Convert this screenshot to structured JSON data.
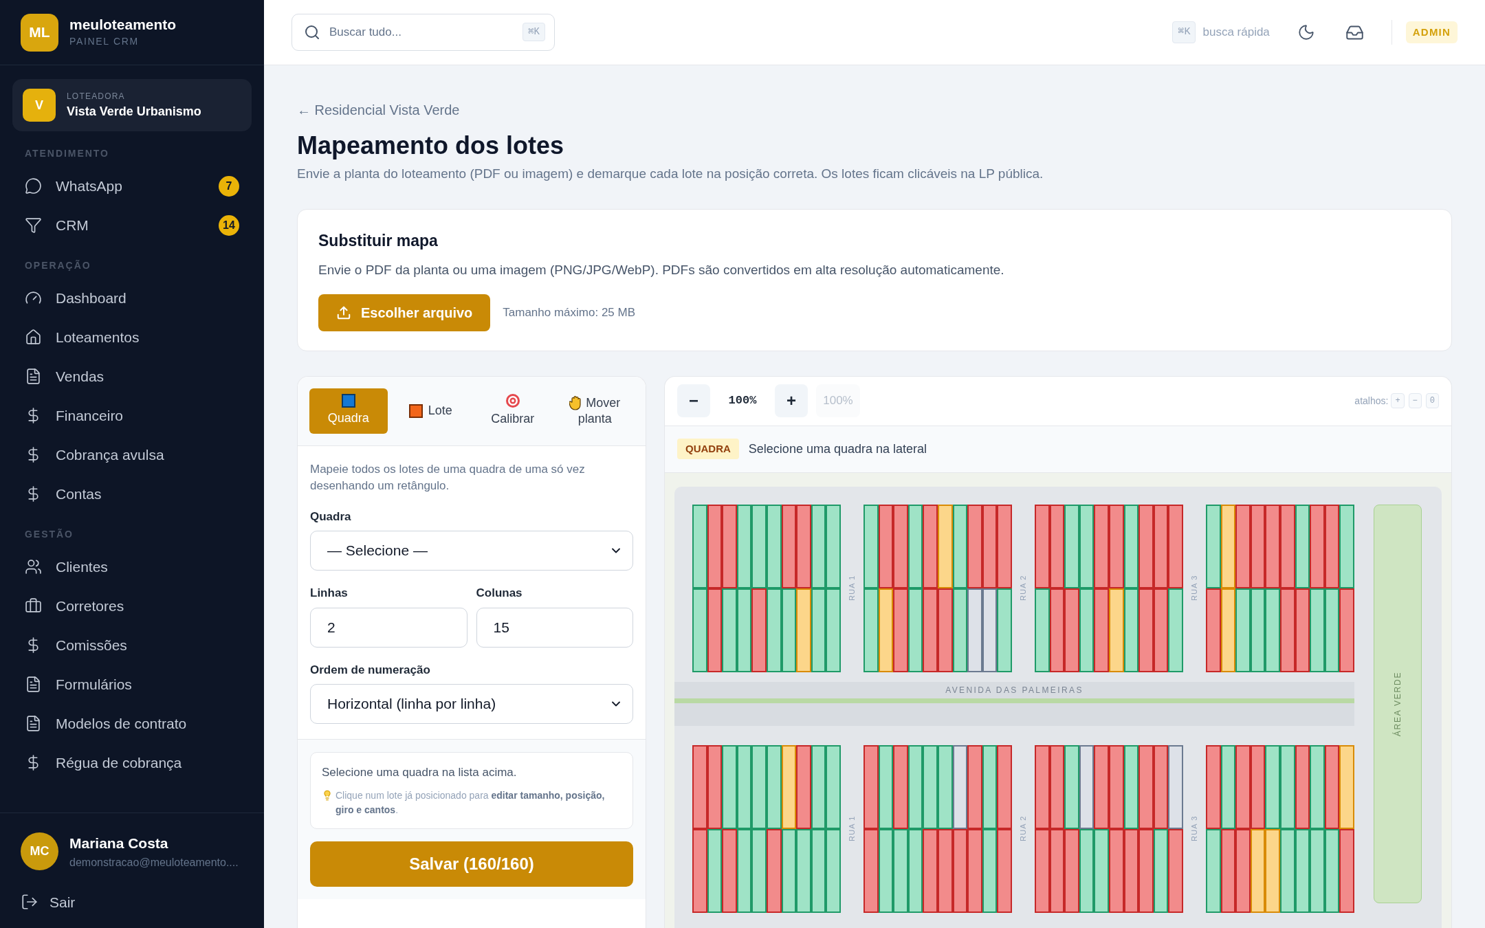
{
  "sidebar": {
    "logo": {
      "initials": "ML",
      "name": "meuloteamento",
      "subtitle": "PAINEL CRM"
    },
    "company": {
      "initial": "V",
      "label": "LOTEADORA",
      "name": "Vista Verde Urbanismo"
    },
    "sections": [
      {
        "title": "ATENDIMENTO",
        "items": [
          {
            "label": "WhatsApp",
            "badge": "7"
          },
          {
            "label": "CRM",
            "badge": "14"
          }
        ]
      },
      {
        "title": "OPERAÇÃO",
        "items": [
          {
            "label": "Dashboard"
          },
          {
            "label": "Loteamentos"
          },
          {
            "label": "Vendas"
          },
          {
            "label": "Financeiro"
          },
          {
            "label": "Cobrança avulsa"
          },
          {
            "label": "Contas"
          }
        ]
      },
      {
        "title": "GESTÃO",
        "items": [
          {
            "label": "Clientes"
          },
          {
            "label": "Corretores"
          },
          {
            "label": "Comissões"
          },
          {
            "label": "Formulários"
          },
          {
            "label": "Modelos de contrato"
          },
          {
            "label": "Régua de cobrança"
          }
        ]
      }
    ],
    "user": {
      "initials": "MC",
      "name": "Mariana Costa",
      "email": "demonstracao@meuloteamento...."
    },
    "logout": "Sair"
  },
  "topbar": {
    "search": {
      "placeholder": "Buscar tudo...",
      "shortcut": "⌘K"
    },
    "quick_search": {
      "shortcut": "⌘K",
      "label": "busca rápida"
    },
    "role": "ADMIN"
  },
  "breadcrumb": "← Residencial Vista Verde",
  "title": "Mapeamento dos lotes",
  "description": "Envie a planta do loteamento (PDF ou imagem) e demarque cada lote na posição correta. Os lotes ficam clicáveis na LP pública.",
  "upload": {
    "title": "Substituir mapa",
    "text": "Envie o PDF da planta ou uma imagem (PNG/JPG/WebP). PDFs são convertidos em alta resolução automaticamente.",
    "button": "Escolher arquivo",
    "hint": "Tamanho máximo: 25 MB"
  },
  "tools": {
    "tabs": [
      {
        "label": "Quadra",
        "selected": true
      },
      {
        "label": "Lote",
        "selected": false
      },
      {
        "label": "Calibrar",
        "selected": false
      },
      {
        "label": "Mover planta",
        "selected": false
      }
    ],
    "help": "Mapeie todos os lotes de uma quadra de uma só vez desenhando um retângulo.",
    "block_field": {
      "label": "Quadra",
      "value": "— Selecione —"
    },
    "rows_field": {
      "label": "Linhas",
      "value": "2"
    },
    "cols_field": {
      "label": "Colunas",
      "value": "15"
    },
    "order_field": {
      "label": "Ordem de numeração",
      "value": "Horizontal (linha por linha)"
    },
    "info": {
      "text": "Selecione uma quadra na lista acima.",
      "tip": "Clique num lote já posicionado para **editar tamanho, posição, giro e cantos**."
    },
    "save": "Salvar (160/160)"
  },
  "map": {
    "zoom_out": "−",
    "zoom": "100%",
    "zoom_in": "+",
    "zoom_reset": "100%",
    "shortcuts_label": "atalhos:",
    "shortcuts": [
      "+",
      "−",
      "0"
    ],
    "mode": {
      "badge": "QUADRA",
      "text": "Selecione uma quadra na lateral"
    },
    "streets_top": [
      "RUA 1",
      "RUA 2",
      "RUA 3"
    ],
    "streets_bottom": [
      "RUA 1",
      "RUA 2",
      "RUA 3"
    ],
    "avenue": "AVENIDA DAS PALMEIRAS",
    "green_area": "ÁREA VERDE",
    "blocks": [
      {
        "rows": [
          [
            {
              "color": "#9fe3c6"
            },
            {
              "color": "#f28b8b"
            },
            {
              "color": "#f28b8b"
            },
            {
              "color": "#9fe3c6"
            },
            {
              "color": "#9fe3c6"
            },
            {
              "color": "#9fe3c6"
            },
            {
              "color": "#f28b8b"
            },
            {
              "color": "#f28b8b"
            },
            {
              "color": "#9fe3c6"
            },
            {
              "color": "#9fe3c6"
            }
          ],
          [
            {
              "color": "#9fe3c6"
            },
            {
              "color": "#f28b8b"
            },
            {
              "color": "#9fe3c6"
            },
            {
              "color": "#9fe3c6"
            },
            {
              "color": "#f28b8b"
            },
            {
              "color": "#9fe3c6"
            },
            {
              "color": "#9fe3c6"
            },
            {
              "color": "#fcd68a"
            },
            {
              "color": "#9fe3c6"
            },
            {
              "color": "#9fe3c6"
            }
          ]
        ]
      },
      {
        "rows": [
          [
            {
              "color": "#9fe3c6"
            },
            {
              "color": "#f28b8b"
            },
            {
              "color": "#f28b8b"
            },
            {
              "color": "#9fe3c6"
            },
            {
              "color": "#f28b8b"
            },
            {
              "color": "#fcd68a"
            },
            {
              "color": "#9fe3c6"
            },
            {
              "color": "#f28b8b"
            },
            {
              "color": "#f28b8b"
            },
            {
              "color": "#f28b8b"
            }
          ],
          [
            {
              "color": "#9fe3c6"
            },
            {
              "color": "#fcd68a"
            },
            {
              "color": "#f28b8b"
            },
            {
              "color": "#9fe3c6"
            },
            {
              "color": "#f28b8b"
            },
            {
              "color": "#f28b8b"
            },
            {
              "color": "#9fe3c6"
            },
            {
              "color": "#dde1e8"
            },
            {
              "color": "#dde1e8"
            },
            {
              "color": "#9fe3c6"
            }
          ]
        ]
      },
      {
        "rows": [
          [
            {
              "color": "#f28b8b"
            },
            {
              "color": "#f28b8b"
            },
            {
              "color": "#9fe3c6"
            },
            {
              "color": "#9fe3c6"
            },
            {
              "color": "#f28b8b"
            },
            {
              "color": "#f28b8b"
            },
            {
              "color": "#9fe3c6"
            },
            {
              "color": "#f28b8b"
            },
            {
              "color": "#f28b8b"
            },
            {
              "color": "#f28b8b"
            }
          ],
          [
            {
              "color": "#9fe3c6"
            },
            {
              "color": "#f28b8b"
            },
            {
              "color": "#f28b8b"
            },
            {
              "color": "#9fe3c6"
            },
            {
              "color": "#f28b8b"
            },
            {
              "color": "#fcd68a"
            },
            {
              "color": "#9fe3c6"
            },
            {
              "color": "#f28b8b"
            },
            {
              "color": "#f28b8b"
            },
            {
              "color": "#9fe3c6"
            }
          ]
        ]
      },
      {
        "rows": [
          [
            {
              "color": "#9fe3c6"
            },
            {
              "color": "#fcd68a"
            },
            {
              "color": "#f28b8b"
            },
            {
              "color": "#f28b8b"
            },
            {
              "color": "#f28b8b"
            },
            {
              "color": "#f28b8b"
            },
            {
              "color": "#9fe3c6"
            },
            {
              "color": "#f28b8b"
            },
            {
              "color": "#f28b8b"
            },
            {
              "color": "#9fe3c6"
            }
          ],
          [
            {
              "color": "#f28b8b"
            },
            {
              "color": "#fcd68a"
            },
            {
              "color": "#9fe3c6"
            },
            {
              "color": "#9fe3c6"
            },
            {
              "color": "#9fe3c6"
            },
            {
              "color": "#f28b8b"
            },
            {
              "color": "#f28b8b"
            },
            {
              "color": "#9fe3c6"
            },
            {
              "color": "#9fe3c6"
            },
            {
              "color": "#f28b8b"
            }
          ]
        ]
      },
      {
        "rows": [
          [
            {
              "color": "#f28b8b"
            },
            {
              "color": "#f28b8b"
            },
            {
              "color": "#9fe3c6"
            },
            {
              "color": "#9fe3c6"
            },
            {
              "color": "#9fe3c6"
            },
            {
              "color": "#9fe3c6"
            },
            {
              "color": "#fcd68a"
            },
            {
              "color": "#f28b8b"
            },
            {
              "color": "#9fe3c6"
            },
            {
              "color": "#9fe3c6"
            }
          ],
          [
            {
              "color": "#f28b8b"
            },
            {
              "color": "#9fe3c6"
            },
            {
              "color": "#f28b8b"
            },
            {
              "color": "#9fe3c6"
            },
            {
              "color": "#9fe3c6"
            },
            {
              "color": "#f28b8b"
            },
            {
              "color": "#9fe3c6"
            },
            {
              "color": "#9fe3c6"
            },
            {
              "color": "#9fe3c6"
            },
            {
              "color": "#9fe3c6"
            }
          ]
        ]
      },
      {
        "rows": [
          [
            {
              "color": "#f28b8b"
            },
            {
              "color": "#9fe3c6"
            },
            {
              "color": "#f28b8b"
            },
            {
              "color": "#9fe3c6"
            },
            {
              "color": "#9fe3c6"
            },
            {
              "color": "#9fe3c6"
            },
            {
              "color": "#dde1e8"
            },
            {
              "color": "#f28b8b"
            },
            {
              "color": "#9fe3c6"
            },
            {
              "color": "#f28b8b"
            }
          ],
          [
            {
              "color": "#f28b8b"
            },
            {
              "color": "#9fe3c6"
            },
            {
              "color": "#9fe3c6"
            },
            {
              "color": "#9fe3c6"
            },
            {
              "color": "#f28b8b"
            },
            {
              "color": "#f28b8b"
            },
            {
              "color": "#f28b8b"
            },
            {
              "color": "#f28b8b"
            },
            {
              "color": "#9fe3c6"
            },
            {
              "color": "#f28b8b"
            }
          ]
        ]
      },
      {
        "rows": [
          [
            {
              "color": "#f28b8b"
            },
            {
              "color": "#f28b8b"
            },
            {
              "color": "#9fe3c6"
            },
            {
              "color": "#dde1e8"
            },
            {
              "color": "#f28b8b"
            },
            {
              "color": "#f28b8b"
            },
            {
              "color": "#9fe3c6"
            },
            {
              "color": "#f28b8b"
            },
            {
              "color": "#f28b8b"
            },
            {
              "color": "#dde1e8"
            }
          ],
          [
            {
              "color": "#f28b8b"
            },
            {
              "color": "#f28b8b"
            },
            {
              "color": "#f28b8b"
            },
            {
              "color": "#9fe3c6"
            },
            {
              "color": "#9fe3c6"
            },
            {
              "color": "#f28b8b"
            },
            {
              "color": "#f28b8b"
            },
            {
              "color": "#f28b8b"
            },
            {
              "color": "#9fe3c6"
            },
            {
              "color": "#f28b8b"
            }
          ]
        ]
      },
      {
        "rows": [
          [
            {
              "color": "#f28b8b"
            },
            {
              "color": "#9fe3c6"
            },
            {
              "color": "#f28b8b"
            },
            {
              "color": "#f28b8b"
            },
            {
              "color": "#9fe3c6"
            },
            {
              "color": "#9fe3c6"
            },
            {
              "color": "#f28b8b"
            },
            {
              "color": "#9fe3c6"
            },
            {
              "color": "#f28b8b"
            },
            {
              "color": "#fcd68a"
            }
          ],
          [
            {
              "color": "#9fe3c6"
            },
            {
              "color": "#f28b8b"
            },
            {
              "color": "#f28b8b"
            },
            {
              "color": "#fcd68a"
            },
            {
              "color": "#fcd68a"
            },
            {
              "color": "#9fe3c6"
            },
            {
              "color": "#9fe3c6"
            },
            {
              "color": "#9fe3c6"
            },
            {
              "color": "#9fe3c6"
            },
            {
              "color": "#f28b8b"
            }
          ]
        ]
      }
    ]
  }
}
